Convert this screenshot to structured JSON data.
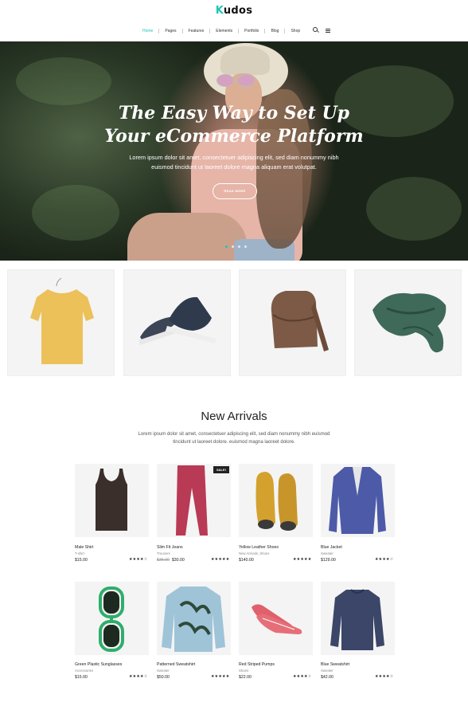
{
  "logo": {
    "first_letter": "K",
    "rest": "udos"
  },
  "nav": {
    "items": [
      "Home",
      "Pages",
      "Features",
      "Elements",
      "Portfolio",
      "Blog",
      "Shop"
    ],
    "active": "Home",
    "icons": [
      "search-icon",
      "menu-icon"
    ]
  },
  "hero": {
    "title_line1": "The Easy Way to Set Up",
    "title_line2": "Your eCommerce Platform",
    "text_line1": "Lorem ipsum dolor sit amet, consectetuer adipiscing elit, sed diam nonummy nibh",
    "text_line2": "euismod tincidunt ut laoreet dolore magna aliquam erat volutpat.",
    "button": "READ MORE",
    "active_slide": 1
  },
  "categories": [
    "t-shirt",
    "shoes",
    "bag",
    "scarf"
  ],
  "arrivals": {
    "title": "New Arrivals",
    "subtitle_line1": "Lorem ipsum dolor sit amet, consectetuer adipiscing elit, sed diam nonummy nibh euismod",
    "subtitle_line2": "tincidunt ut laoreet dolore. euismod magna laoreet dolore.",
    "products": [
      {
        "name": "Male Shirt",
        "category": "T-shirt",
        "price": "$15.00",
        "old_price": "",
        "badge": "",
        "stars": "★★★★☆",
        "image": "tank-top"
      },
      {
        "name": "Slim Fit Jeans",
        "category": "Trousers",
        "price": "$30.00",
        "old_price": "$35.00",
        "badge": "SALE!",
        "stars": "★★★★★",
        "image": "jeans"
      },
      {
        "name": "Yellow Leather Shoes",
        "category": "New Arrivals, Shoes",
        "price": "$140.00",
        "old_price": "",
        "badge": "",
        "stars": "★★★★★",
        "image": "boots"
      },
      {
        "name": "Blue Jacket",
        "category": "Sweater",
        "price": "$129.00",
        "old_price": "",
        "badge": "",
        "stars": "★★★★☆",
        "image": "jacket"
      },
      {
        "name": "Green Plastic Sunglasses",
        "category": "Accessories",
        "price": "$15.00",
        "old_price": "",
        "badge": "",
        "stars": "★★★★☆",
        "image": "sunglasses"
      },
      {
        "name": "Patterned Sweatshirt",
        "category": "Sweater",
        "price": "$50.00",
        "old_price": "",
        "badge": "",
        "stars": "★★★★★",
        "image": "sweatshirt"
      },
      {
        "name": "Red Striped Pumps",
        "category": "Shoes",
        "price": "$22.00",
        "old_price": "",
        "badge": "",
        "stars": "★★★★☆",
        "image": "pumps"
      },
      {
        "name": "Blue Sweatshirt",
        "category": "Sweater",
        "price": "$42.00",
        "old_price": "",
        "badge": "",
        "stars": "★★★★☆",
        "image": "blue-sweatshirt"
      }
    ]
  }
}
